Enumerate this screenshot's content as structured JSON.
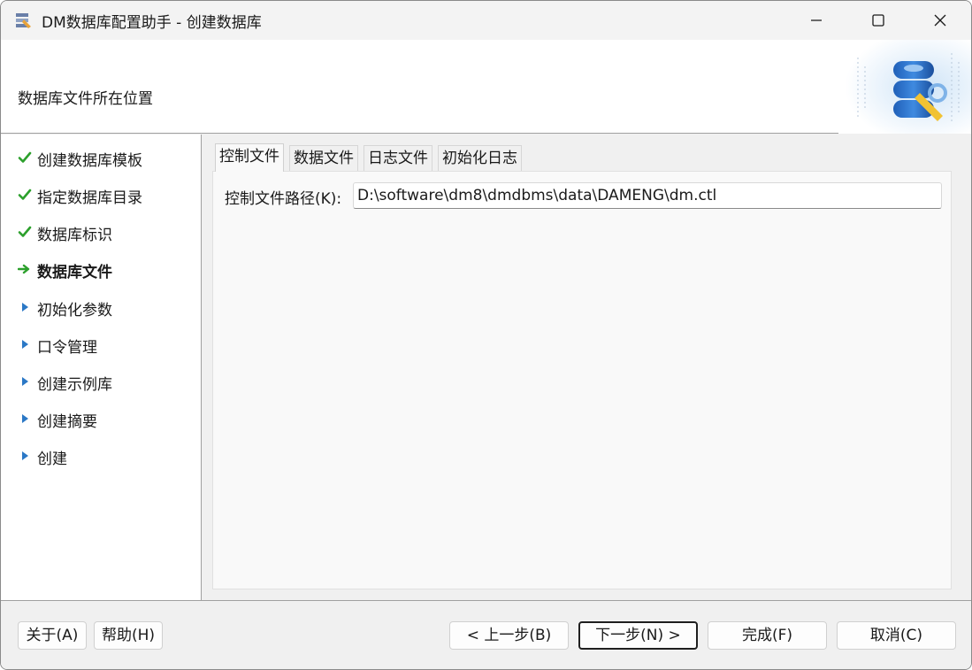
{
  "window": {
    "title": "DM数据库配置助手 - 创建数据库"
  },
  "header": {
    "title": "数据库文件所在位置"
  },
  "steps": [
    {
      "label": "创建数据库模板",
      "status": "done"
    },
    {
      "label": "指定数据库目录",
      "status": "done"
    },
    {
      "label": "数据库标识",
      "status": "done"
    },
    {
      "label": "数据库文件",
      "status": "current"
    },
    {
      "label": "初始化参数",
      "status": "pending"
    },
    {
      "label": "口令管理",
      "status": "pending"
    },
    {
      "label": "创建示例库",
      "status": "pending"
    },
    {
      "label": "创建摘要",
      "status": "pending"
    },
    {
      "label": "创建",
      "status": "pending"
    }
  ],
  "tabs": [
    {
      "label": "控制文件",
      "active": true
    },
    {
      "label": "数据文件",
      "active": false
    },
    {
      "label": "日志文件",
      "active": false
    },
    {
      "label": "初始化日志",
      "active": false
    }
  ],
  "control_file": {
    "label": "控制文件路径(K):",
    "value": "D:\\software\\dm8\\dmdbms\\data\\DAMENG\\dm.ctl"
  },
  "footer": {
    "about": "关于(A)",
    "help": "帮助(H)",
    "prev": "< 上一步(B)",
    "next": "下一步(N) >",
    "finish": "完成(F)",
    "cancel": "取消(C)"
  },
  "colors": {
    "done_check": "#2ca02c",
    "current_arrow": "#2ca02c",
    "pending_arrow": "#2b78c6"
  }
}
